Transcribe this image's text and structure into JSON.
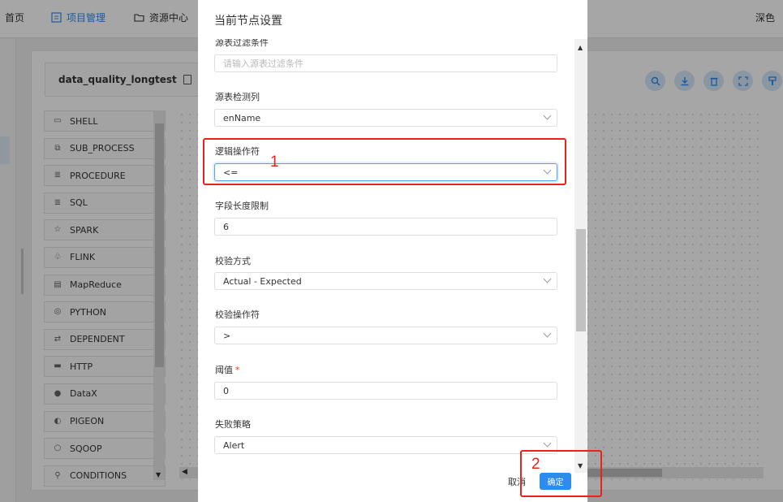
{
  "topnav": {
    "home": "首页",
    "project": "项目管理",
    "resource": "资源中心",
    "theme": "深色"
  },
  "workflow": {
    "title": "data_quality_longtest"
  },
  "toolbar": [
    "search-icon",
    "download-icon",
    "delete-icon",
    "fullscreen-icon",
    "format-icon"
  ],
  "nodes": [
    {
      "label": "SHELL",
      "icon": "shell-icon"
    },
    {
      "label": "SUB_PROCESS",
      "icon": "subprocess-icon"
    },
    {
      "label": "PROCEDURE",
      "icon": "procedure-icon"
    },
    {
      "label": "SQL",
      "icon": "sql-icon"
    },
    {
      "label": "SPARK",
      "icon": "spark-icon"
    },
    {
      "label": "FLINK",
      "icon": "flink-icon"
    },
    {
      "label": "MapReduce",
      "icon": "mapreduce-icon"
    },
    {
      "label": "PYTHON",
      "icon": "python-icon"
    },
    {
      "label": "DEPENDENT",
      "icon": "dependent-icon"
    },
    {
      "label": "HTTP",
      "icon": "http-icon"
    },
    {
      "label": "DataX",
      "icon": "datax-icon"
    },
    {
      "label": "PIGEON",
      "icon": "pigeon-icon"
    },
    {
      "label": "SQOOP",
      "icon": "sqoop-icon"
    },
    {
      "label": "CONDITIONS",
      "icon": "conditions-icon"
    }
  ],
  "drawer": {
    "title": "当前节点设置",
    "fields": {
      "filter_label": "源表过滤条件",
      "filter_placeholder": "请输入源表过滤条件",
      "check_col_label": "源表检测列",
      "check_col_value": "enName",
      "logic_op_label": "逻辑操作符",
      "logic_op_value": "<=",
      "field_len_label": "字段长度限制",
      "field_len_value": "6",
      "check_method_label": "校验方式",
      "check_method_value": "Actual - Expected",
      "check_op_label": "校验操作符",
      "check_op_value": ">",
      "threshold_label": "阈值",
      "threshold_required": "*",
      "threshold_value": "0",
      "fail_strategy_label": "失败策略",
      "fail_strategy_value": "Alert"
    },
    "cancel": "取消",
    "confirm": "确定"
  },
  "annotations": {
    "one": "1",
    "two": "2",
    "color": "#e8221c"
  },
  "colors": {
    "primary": "#2d8cf0"
  }
}
